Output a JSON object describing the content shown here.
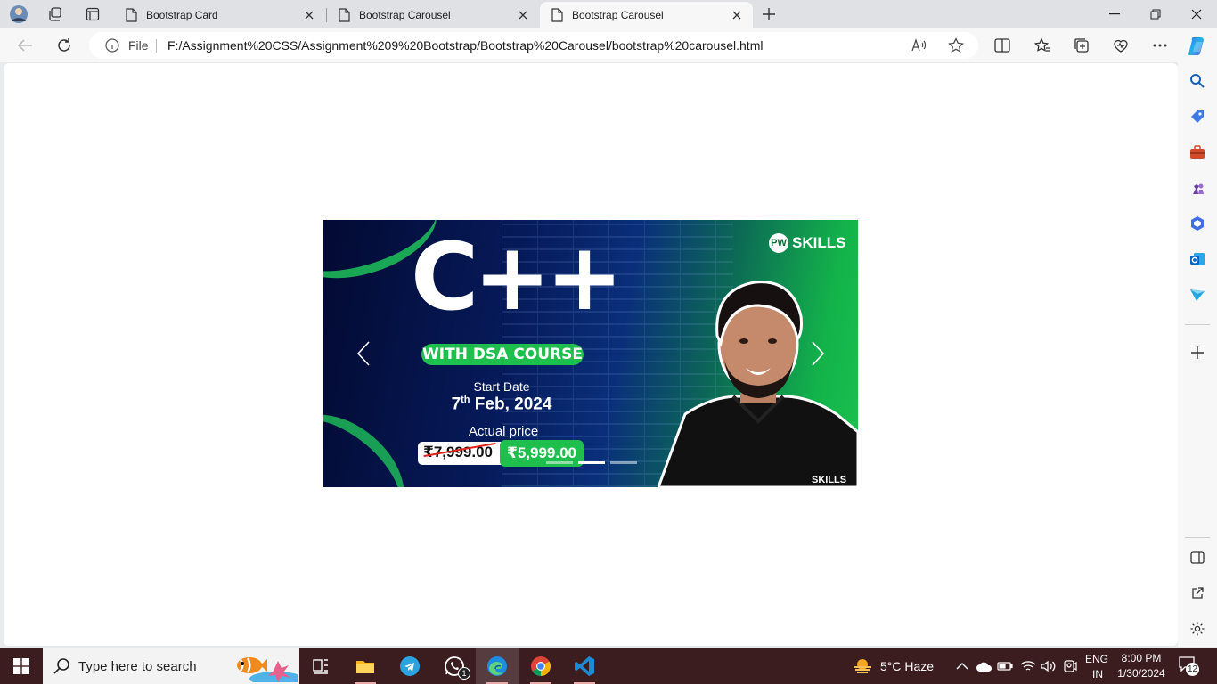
{
  "browser": {
    "tabs": [
      {
        "title": "Bootstrap Card",
        "active": false
      },
      {
        "title": "Bootstrap Carousel",
        "active": false
      },
      {
        "title": "Bootstrap Carousel",
        "active": true
      }
    ],
    "address": {
      "scheme_label": "File",
      "url": "F:/Assignment%20CSS/Assignment%209%20Bootstrap/Bootstrap%20Carousel/bootstrap%20carousel.html"
    }
  },
  "carousel": {
    "title": "C++",
    "pill": "WITH DSA COURSE",
    "start_label": "Start Date",
    "start_day": "7",
    "start_suffix": "th",
    "start_rest": " Feb, 2024",
    "actual_label": "Actual price",
    "old_price": "₹7,999.00",
    "new_price": "₹5,999.00",
    "logo_text": "SKILLS",
    "logo_badge": "PW",
    "shirt_text": "SKILLS",
    "indicator_count": 3,
    "active_indicator": 2
  },
  "taskbar": {
    "search_placeholder": "Type here to search",
    "whatsapp_badge": "1",
    "weather": "5°C  Haze",
    "lang_top": "ENG",
    "lang_bottom": "IN",
    "time": "8:00 PM",
    "date": "1/30/2024",
    "notifications": "12"
  },
  "colors": {
    "accent_green": "#1fbf4e",
    "taskbar_bg": "#3b1c1f",
    "banner_navy": "#061a5a"
  }
}
